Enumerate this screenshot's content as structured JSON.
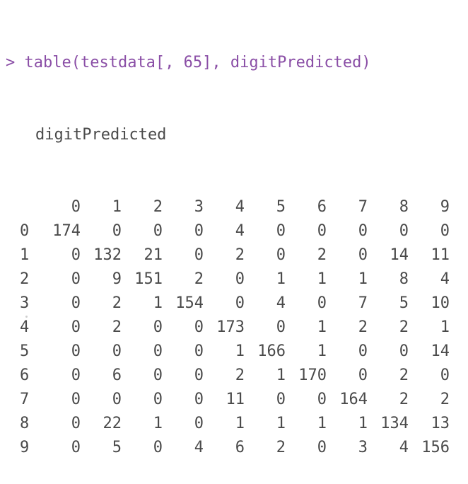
{
  "console": {
    "prompt": ">",
    "command": "table(testdata[, 65], digitPredicted)",
    "dimnames_label": "digitPredicted"
  },
  "table": {
    "column_labels": [
      "0",
      "1",
      "2",
      "3",
      "4",
      "5",
      "6",
      "7",
      "8",
      "9"
    ],
    "rows": [
      {
        "label": "0",
        "values": [
          "174",
          "0",
          "0",
          "0",
          "4",
          "0",
          "0",
          "0",
          "0",
          "0"
        ]
      },
      {
        "label": "1",
        "values": [
          "0",
          "132",
          "21",
          "0",
          "2",
          "0",
          "2",
          "0",
          "14",
          "11"
        ]
      },
      {
        "label": "2",
        "values": [
          "0",
          "9",
          "151",
          "2",
          "0",
          "1",
          "1",
          "1",
          "8",
          "4"
        ]
      },
      {
        "label": "3",
        "values": [
          "0",
          "2",
          "1",
          "154",
          "0",
          "4",
          "0",
          "7",
          "5",
          "10"
        ]
      },
      {
        "label": "4",
        "values": [
          "0",
          "2",
          "0",
          "0",
          "173",
          "0",
          "1",
          "2",
          "2",
          "1"
        ]
      },
      {
        "label": "5",
        "values": [
          "0",
          "0",
          "0",
          "0",
          "1",
          "166",
          "1",
          "0",
          "0",
          "14"
        ]
      },
      {
        "label": "6",
        "values": [
          "0",
          "6",
          "0",
          "0",
          "2",
          "1",
          "170",
          "0",
          "2",
          "0"
        ]
      },
      {
        "label": "7",
        "values": [
          "0",
          "0",
          "0",
          "0",
          "11",
          "0",
          "0",
          "164",
          "2",
          "2"
        ]
      },
      {
        "label": "8",
        "values": [
          "0",
          "22",
          "1",
          "0",
          "1",
          "1",
          "1",
          "1",
          "134",
          "13"
        ]
      },
      {
        "label": "9",
        "values": [
          "0",
          "5",
          "0",
          "4",
          "6",
          "2",
          "0",
          "3",
          "4",
          "156"
        ]
      }
    ]
  },
  "colors": {
    "command": "#8a4ea6",
    "output": "#4a4a4a",
    "background": "#ffffff"
  }
}
